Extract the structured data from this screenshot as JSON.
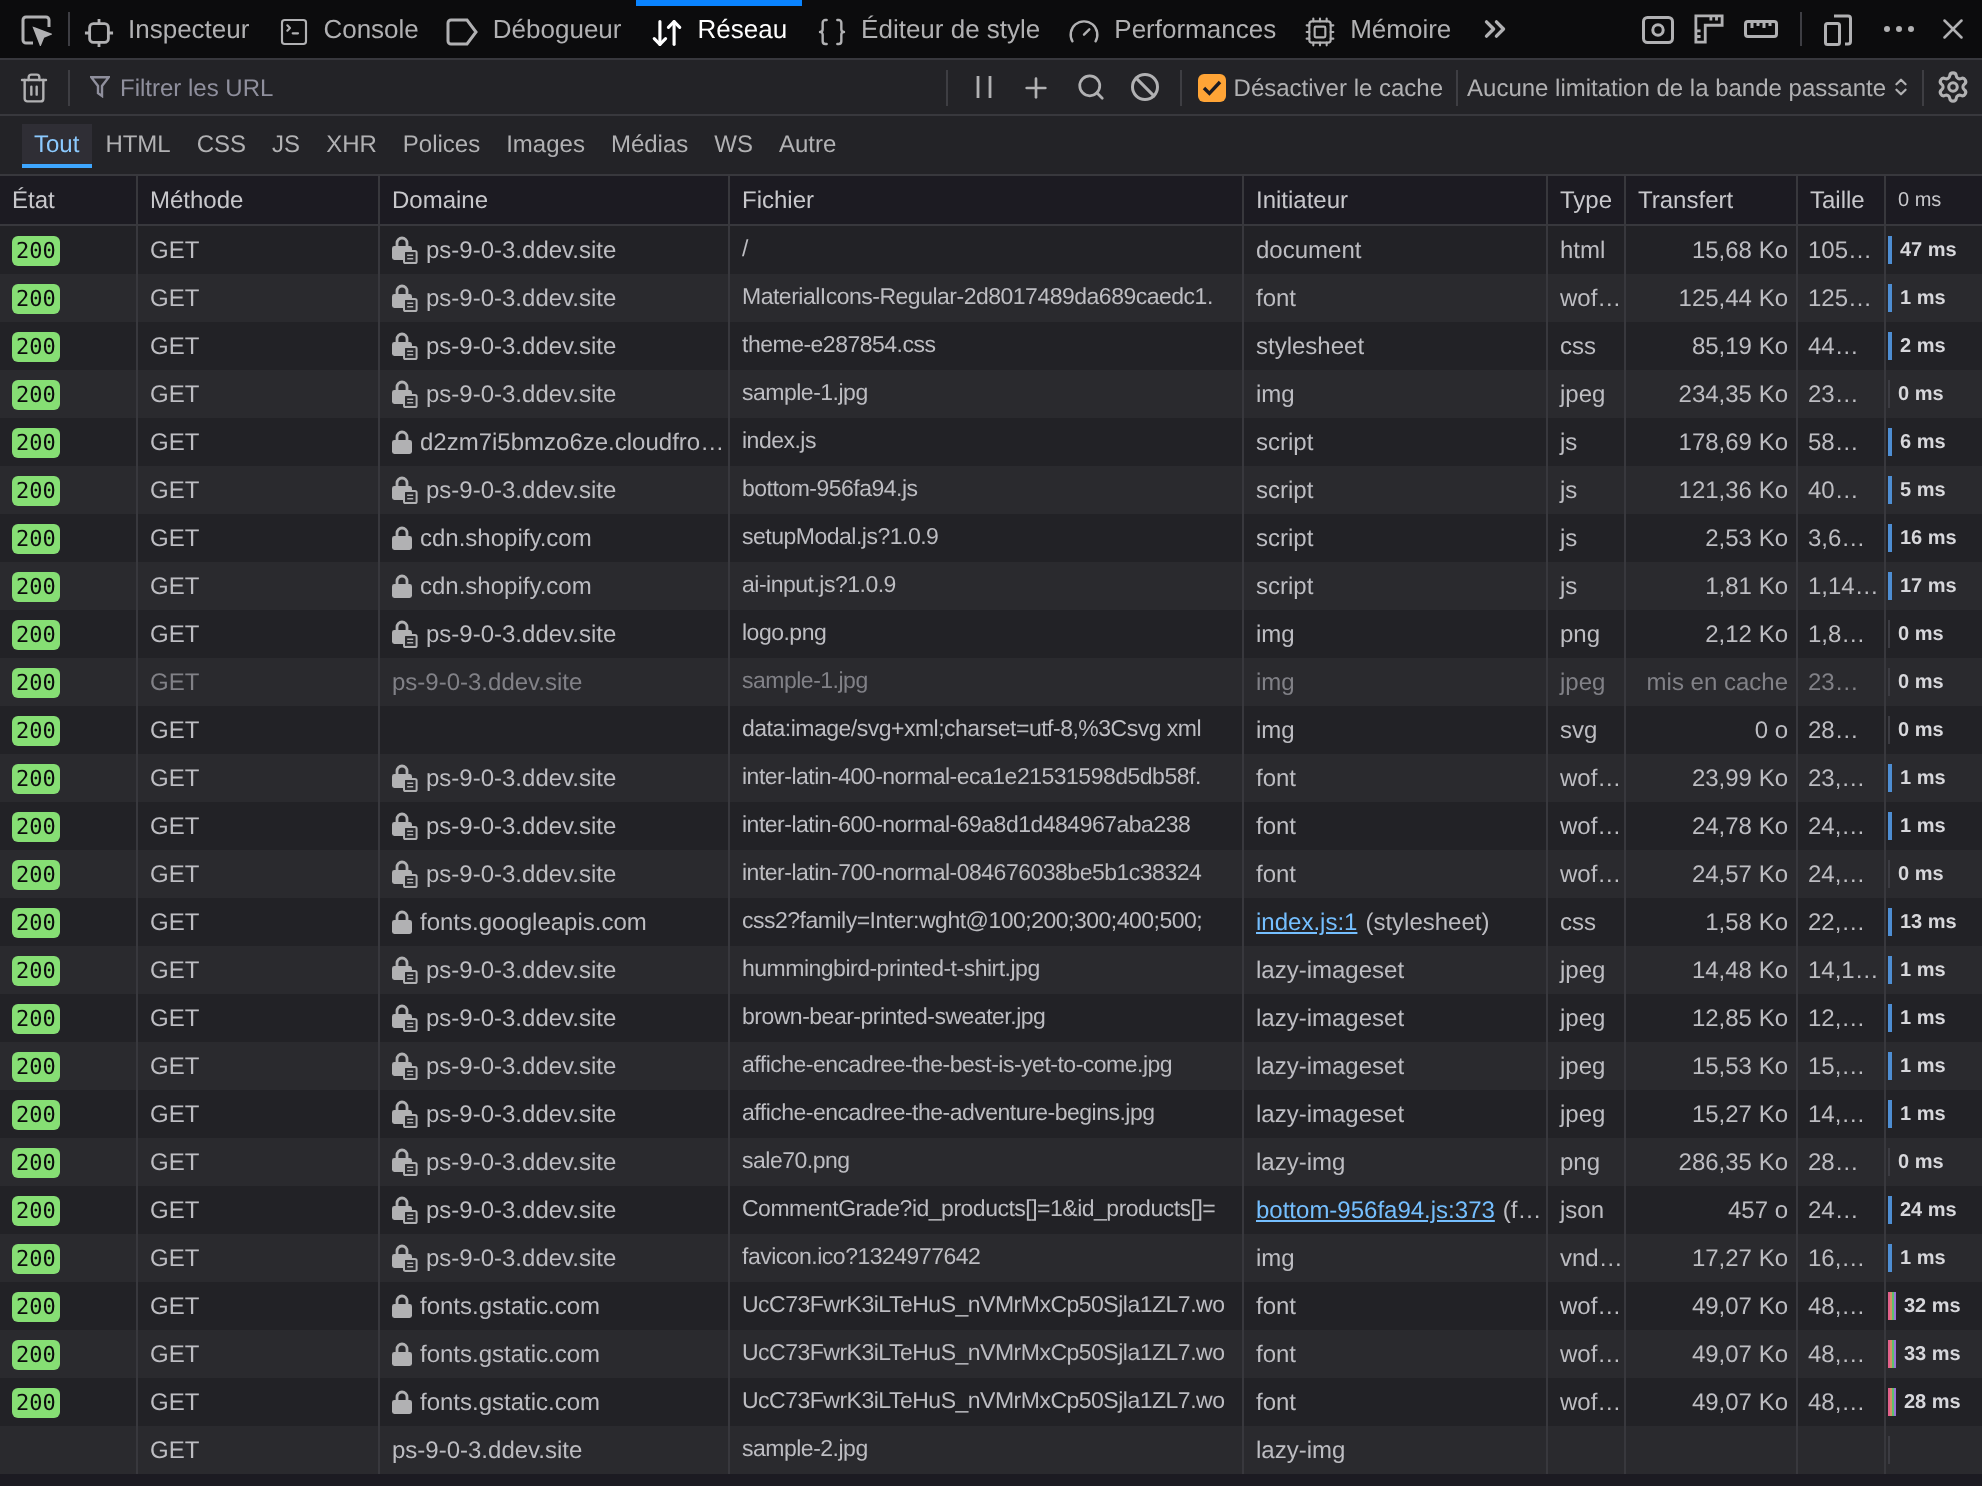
{
  "toolbox": {
    "tabs": [
      {
        "label": "Inspecteur",
        "selected": false
      },
      {
        "label": "Console",
        "selected": false
      },
      {
        "label": "Débogueur",
        "selected": false
      },
      {
        "label": "Réseau",
        "selected": true
      },
      {
        "label": "Éditeur de style",
        "selected": false
      },
      {
        "label": "Performances",
        "selected": false
      },
      {
        "label": "Mémoire",
        "selected": false
      }
    ]
  },
  "toolbar": {
    "filter": {
      "placeholder": "Filtrer les URL"
    },
    "disable_cache": {
      "label": "Désactiver le cache",
      "checked": true
    },
    "throttling": {
      "value": "Aucune limitation de la bande passante"
    }
  },
  "type_filters": [
    {
      "label": "Tout",
      "selected": true
    },
    {
      "label": "HTML",
      "selected": false
    },
    {
      "label": "CSS",
      "selected": false
    },
    {
      "label": "JS",
      "selected": false
    },
    {
      "label": "XHR",
      "selected": false
    },
    {
      "label": "Polices",
      "selected": false
    },
    {
      "label": "Images",
      "selected": false
    },
    {
      "label": "Médias",
      "selected": false
    },
    {
      "label": "WS",
      "selected": false
    },
    {
      "label": "Autre",
      "selected": false
    }
  ],
  "table": {
    "columns": [
      "État",
      "Méthode",
      "Domaine",
      "Fichier",
      "Initiateur",
      "Type",
      "Transfert",
      "Taille",
      "0 ms"
    ],
    "rows": [
      {
        "status": "200",
        "method": "GET",
        "secure": true,
        "badge": true,
        "domain": "ps-9-0-3.ddev.site",
        "file": "/",
        "initiator": "document",
        "type": "html",
        "transferred": "15,68 Ko",
        "size": "105…",
        "bar": {
          "kind": "solid"
        },
        "timing": "47 ms",
        "cached": false
      },
      {
        "status": "200",
        "method": "GET",
        "secure": true,
        "badge": true,
        "domain": "ps-9-0-3.ddev.site",
        "file": "MaterialIcons-Regular-2d8017489da689caedc1.",
        "initiator": "font",
        "type": "wof…",
        "transferred": "125,44 Ko",
        "size": "125…",
        "bar": {
          "kind": "solid"
        },
        "timing": "1 ms",
        "cached": false
      },
      {
        "status": "200",
        "method": "GET",
        "secure": true,
        "badge": true,
        "domain": "ps-9-0-3.ddev.site",
        "file": "theme-e287854.css",
        "initiator": "stylesheet",
        "type": "css",
        "transferred": "85,19 Ko",
        "size": "44…",
        "bar": {
          "kind": "solid"
        },
        "timing": "2 ms",
        "cached": false
      },
      {
        "status": "200",
        "method": "GET",
        "secure": true,
        "badge": true,
        "domain": "ps-9-0-3.ddev.site",
        "file": "sample-1.jpg",
        "initiator": "img",
        "type": "jpeg",
        "transferred": "234,35 Ko",
        "size": "23…",
        "bar": {
          "kind": "faint"
        },
        "timing": "0 ms",
        "cached": false
      },
      {
        "status": "200",
        "method": "GET",
        "secure": true,
        "badge": false,
        "domain": "d2zm7i5bmzo6ze.cloudfro…",
        "file": "index.js",
        "initiator": "script",
        "type": "js",
        "transferred": "178,69 Ko",
        "size": "58…",
        "bar": {
          "kind": "solid"
        },
        "timing": "6 ms",
        "cached": false
      },
      {
        "status": "200",
        "method": "GET",
        "secure": true,
        "badge": true,
        "domain": "ps-9-0-3.ddev.site",
        "file": "bottom-956fa94.js",
        "initiator": "script",
        "type": "js",
        "transferred": "121,36 Ko",
        "size": "40…",
        "bar": {
          "kind": "solid"
        },
        "timing": "5 ms",
        "cached": false
      },
      {
        "status": "200",
        "method": "GET",
        "secure": true,
        "badge": false,
        "domain": "cdn.shopify.com",
        "file": "setupModal.js?1.0.9",
        "initiator": "script",
        "type": "js",
        "transferred": "2,53 Ko",
        "size": "3,6…",
        "bar": {
          "kind": "solid"
        },
        "timing": "16 ms",
        "cached": false
      },
      {
        "status": "200",
        "method": "GET",
        "secure": true,
        "badge": false,
        "domain": "cdn.shopify.com",
        "file": "ai-input.js?1.0.9",
        "initiator": "script",
        "type": "js",
        "transferred": "1,81 Ko",
        "size": "1,14…",
        "bar": {
          "kind": "solid"
        },
        "timing": "17 ms",
        "cached": false
      },
      {
        "status": "200",
        "method": "GET",
        "secure": true,
        "badge": true,
        "domain": "ps-9-0-3.ddev.site",
        "file": "logo.png",
        "initiator": "img",
        "type": "png",
        "transferred": "2,12 Ko",
        "size": "1,8…",
        "bar": {
          "kind": "faint"
        },
        "timing": "0 ms",
        "cached": false
      },
      {
        "status": "200",
        "method": "GET",
        "secure": false,
        "badge": false,
        "domain": "ps-9-0-3.ddev.site",
        "file": "sample-1.jpg",
        "initiator": "img",
        "type": "jpeg",
        "transferred": "mis en cache",
        "size": "23…",
        "bar": {
          "kind": "faint"
        },
        "timing": "0 ms",
        "cached": true
      },
      {
        "status": "200",
        "method": "GET",
        "secure": false,
        "badge": false,
        "file": "data:image/svg+xml;charset=utf-8,%3Csvg xml",
        "initiator": "img",
        "type": "svg",
        "transferred": "0 o",
        "size": "28…",
        "bar": {
          "kind": "faint"
        },
        "timing": "0 ms",
        "cached": false
      },
      {
        "status": "200",
        "method": "GET",
        "secure": true,
        "badge": true,
        "domain": "ps-9-0-3.ddev.site",
        "file": "inter-latin-400-normal-eca1e21531598d5db58f.",
        "initiator": "font",
        "type": "wof…",
        "transferred": "23,99 Ko",
        "size": "23,…",
        "bar": {
          "kind": "solid"
        },
        "timing": "1 ms",
        "cached": false
      },
      {
        "status": "200",
        "method": "GET",
        "secure": true,
        "badge": true,
        "domain": "ps-9-0-3.ddev.site",
        "file": "inter-latin-600-normal-69a8d1d484967aba238",
        "initiator": "font",
        "type": "wof…",
        "transferred": "24,78 Ko",
        "size": "24,…",
        "bar": {
          "kind": "solid"
        },
        "timing": "1 ms",
        "cached": false
      },
      {
        "status": "200",
        "method": "GET",
        "secure": true,
        "badge": true,
        "domain": "ps-9-0-3.ddev.site",
        "file": "inter-latin-700-normal-084676038be5b1c38324",
        "initiator": "font",
        "type": "wof…",
        "transferred": "24,57 Ko",
        "size": "24,…",
        "bar": {
          "kind": "faint"
        },
        "timing": "0 ms",
        "cached": false
      },
      {
        "status": "200",
        "method": "GET",
        "secure": true,
        "badge": false,
        "domain": "fonts.googleapis.com",
        "file": "css2?family=Inter:wght@100;200;300;400;500;",
        "initiator_link": "index.js:1",
        "initiator": "(stylesheet)",
        "type": "css",
        "transferred": "1,58 Ko",
        "size": "22,…",
        "bar": {
          "kind": "solid"
        },
        "timing": "13 ms",
        "cached": false
      },
      {
        "status": "200",
        "method": "GET",
        "secure": true,
        "badge": true,
        "domain": "ps-9-0-3.ddev.site",
        "file": "hummingbird-printed-t-shirt.jpg",
        "initiator": "lazy-imageset",
        "type": "jpeg",
        "transferred": "14,48 Ko",
        "size": "14,1…",
        "bar": {
          "kind": "solid"
        },
        "timing": "1 ms",
        "cached": false
      },
      {
        "status": "200",
        "method": "GET",
        "secure": true,
        "badge": true,
        "domain": "ps-9-0-3.ddev.site",
        "file": "brown-bear-printed-sweater.jpg",
        "initiator": "lazy-imageset",
        "type": "jpeg",
        "transferred": "12,85 Ko",
        "size": "12,…",
        "bar": {
          "kind": "solid"
        },
        "timing": "1 ms",
        "cached": false
      },
      {
        "status": "200",
        "method": "GET",
        "secure": true,
        "badge": true,
        "domain": "ps-9-0-3.ddev.site",
        "file": "affiche-encadree-the-best-is-yet-to-come.jpg",
        "initiator": "lazy-imageset",
        "type": "jpeg",
        "transferred": "15,53 Ko",
        "size": "15,…",
        "bar": {
          "kind": "solid"
        },
        "timing": "1 ms",
        "cached": false
      },
      {
        "status": "200",
        "method": "GET",
        "secure": true,
        "badge": true,
        "domain": "ps-9-0-3.ddev.site",
        "file": "affiche-encadree-the-adventure-begins.jpg",
        "initiator": "lazy-imageset",
        "type": "jpeg",
        "transferred": "15,27 Ko",
        "size": "14,…",
        "bar": {
          "kind": "solid"
        },
        "timing": "1 ms",
        "cached": false
      },
      {
        "status": "200",
        "method": "GET",
        "secure": true,
        "badge": true,
        "domain": "ps-9-0-3.ddev.site",
        "file": "sale70.png",
        "initiator": "lazy-img",
        "type": "png",
        "transferred": "286,35 Ko",
        "size": "28…",
        "bar": {
          "kind": "faint"
        },
        "timing": "0 ms",
        "cached": false
      },
      {
        "status": "200",
        "method": "GET",
        "secure": true,
        "badge": true,
        "domain": "ps-9-0-3.ddev.site",
        "file": "CommentGrade?id_products[]=1&id_products[]=",
        "initiator_link": "bottom-956fa94.js:373",
        "initiator": "(f…",
        "type": "json",
        "transferred": "457 o",
        "size": "24…",
        "bar": {
          "kind": "solid"
        },
        "timing": "24 ms",
        "cached": false
      },
      {
        "status": "200",
        "method": "GET",
        "secure": true,
        "badge": true,
        "domain": "ps-9-0-3.ddev.site",
        "file": "favicon.ico?1324977642",
        "initiator": "img",
        "type": "vnd…",
        "transferred": "17,27 Ko",
        "size": "16,…",
        "bar": {
          "kind": "solid"
        },
        "timing": "1 ms",
        "cached": false
      },
      {
        "status": "200",
        "method": "GET",
        "secure": true,
        "badge": false,
        "domain": "fonts.gstatic.com",
        "file": "UcC73FwrK3iLTeHuS_nVMrMxCp50Sjla1ZL7.wo",
        "initiator": "font",
        "type": "wof…",
        "transferred": "49,07 Ko",
        "size": "48,…",
        "bar": {
          "kind": "segmented"
        },
        "timing": "32 ms",
        "cached": false
      },
      {
        "status": "200",
        "method": "GET",
        "secure": true,
        "badge": false,
        "domain": "fonts.gstatic.com",
        "file": "UcC73FwrK3iLTeHuS_nVMrMxCp50Sjla1ZL7.wo",
        "initiator": "font",
        "type": "wof…",
        "transferred": "49,07 Ko",
        "size": "48,…",
        "bar": {
          "kind": "segmented"
        },
        "timing": "33 ms",
        "cached": false
      },
      {
        "status": "200",
        "method": "GET",
        "secure": true,
        "badge": false,
        "domain": "fonts.gstatic.com",
        "file": "UcC73FwrK3iLTeHuS_nVMrMxCp50Sjla1ZL7.wo",
        "initiator": "font",
        "type": "wof…",
        "transferred": "49,07 Ko",
        "size": "48,…",
        "bar": {
          "kind": "segmented"
        },
        "timing": "28 ms",
        "cached": false
      },
      {
        "method": "GET",
        "secure": false,
        "badge": false,
        "domain": "ps-9-0-3.ddev.site",
        "file": "sample-2.jpg",
        "initiator": "lazy-img",
        "bar": {
          "kind": "faint"
        },
        "cached": false
      }
    ]
  }
}
